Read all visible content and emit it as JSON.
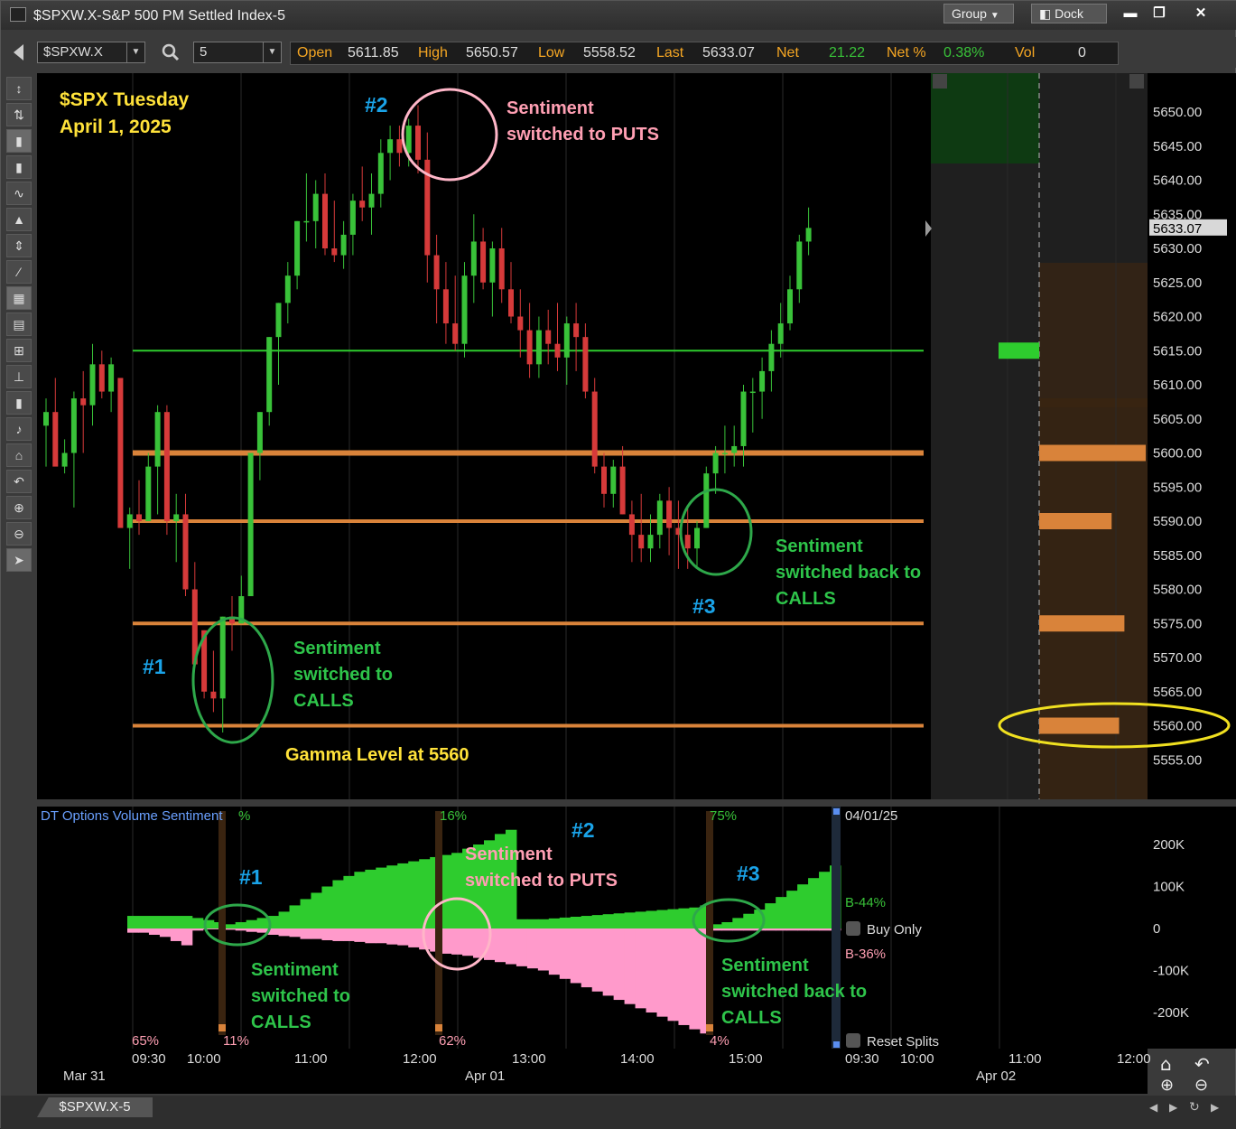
{
  "window": {
    "title": "$SPXW.X-S&P 500 PM Settled Index-5",
    "group_label": "Group",
    "dock_label": "Dock",
    "minimize_icon": "minimize-icon",
    "maximize_icon": "maximize-icon",
    "close_icon": "close-icon"
  },
  "toolbar": {
    "symbol": "$SPXW.X",
    "interval": "5",
    "quote": {
      "open_label": "Open",
      "open": "5611.85",
      "high_label": "High",
      "high": "5650.57",
      "low_label": "Low",
      "low": "5558.52",
      "last_label": "Last",
      "last": "5633.07",
      "net_label": "Net",
      "net": "21.22",
      "netpct_label": "Net %",
      "netpct": "0.38%",
      "vol_label": "Vol",
      "vol": "0"
    }
  },
  "left_tools": [
    "cursor-crosshair-icon",
    "pointer-icon",
    "candle-icon",
    "bar-icon",
    "line-icon",
    "area-icon",
    "fit-icon",
    "trendline-icon",
    "grid-icon",
    "table-icon",
    "level2-icon",
    "hline-icon",
    "flag-icon",
    "text-icon",
    "home-icon",
    "undo-icon",
    "zoom-in-icon",
    "zoom-out-icon",
    "select-icon"
  ],
  "colors": {
    "bg": "#000000",
    "up": "#39c239",
    "down": "#d63a3a",
    "orange": "#d9833a",
    "green_line": "#2ecc2e",
    "annot_green": "#2ec44a",
    "annot_pink": "#ff9fb3",
    "annot_blue": "#1aa3e8",
    "annot_yellow": "#ffe23a",
    "pos_fill": "#2ecc2e",
    "neg_fill": "#ff9acb"
  },
  "price_chart": {
    "title_line1": "$SPX Tuesday",
    "title_line2": "April 1, 2025",
    "y_ticks": [
      "5650.00",
      "5645.00",
      "5640.00",
      "5635.00",
      "5630.00",
      "5625.00",
      "5620.00",
      "5615.00",
      "5610.00",
      "5605.00",
      "5600.00",
      "5595.00",
      "5590.00",
      "5585.00",
      "5580.00",
      "5575.00",
      "5570.00",
      "5565.00",
      "5560.00",
      "5555.00"
    ],
    "last_price_tag": "5633.07",
    "annotations": {
      "n1": "#1",
      "n2": "#2",
      "n3": "#3",
      "a1": [
        "Sentiment",
        "switched to",
        "CALLS"
      ],
      "a2": [
        "Sentiment",
        "switched to PUTS"
      ],
      "a3": [
        "Sentiment",
        "switched back to",
        "CALLS"
      ],
      "gamma": "Gamma Level at 5560"
    }
  },
  "sentiment_panel": {
    "title": "DT Options Volume Sentiment",
    "pct_symbol": "%",
    "pct_top": [
      "16%",
      "75%"
    ],
    "pct_bottom": [
      "65%",
      "11%",
      "62%",
      "4%"
    ],
    "date_label": "04/01/25",
    "buy_label": "B-44%",
    "sell_label": "B-36%",
    "buy_only": "Buy Only",
    "reset_splits": "Reset Splits",
    "y_ticks": [
      "200K",
      "100K",
      "0",
      "-100K",
      "-200K"
    ],
    "annotations": {
      "n1": "#1",
      "n2": "#2",
      "n3": "#3",
      "a1": [
        "Sentiment",
        "switched to",
        "CALLS"
      ],
      "a2": [
        "Sentiment",
        "switched to PUTS"
      ],
      "a3": [
        "Sentiment",
        "switched back to",
        "CALLS"
      ]
    }
  },
  "x_axis": {
    "times": [
      "09:30",
      "10:00",
      "11:00",
      "12:00",
      "13:00",
      "14:00",
      "15:00",
      "09:30",
      "10:00",
      "11:00",
      "12:00"
    ],
    "dates": [
      "Mar 31",
      "Apr 01",
      "Apr 02"
    ]
  },
  "status": {
    "tab_label": "$SPXW.X-5"
  },
  "chart_data": {
    "type": "candlestick",
    "interval_minutes": 5,
    "date": "Apr 01",
    "ylim": [
      5550,
      5655
    ],
    "ohlc": [
      [
        5604,
        5608,
        5598,
        5606
      ],
      [
        5606,
        5611,
        5599,
        5598
      ],
      [
        5598,
        5602,
        5597,
        5600
      ],
      [
        5600,
        5609,
        5592,
        5608
      ],
      [
        5608,
        5612,
        5600,
        5607
      ],
      [
        5607,
        5616,
        5604,
        5613
      ],
      [
        5613,
        5615,
        5608,
        5609
      ],
      [
        5609,
        5614,
        5606,
        5613
      ],
      [
        5611,
        5611,
        5589,
        5589
      ],
      [
        5589,
        5592,
        5583,
        5591
      ],
      [
        5591,
        5596,
        5588,
        5590
      ],
      [
        5590,
        5600,
        5590,
        5598
      ],
      [
        5598,
        5607,
        5591,
        5606
      ],
      [
        5606,
        5607,
        5588,
        5590
      ],
      [
        5590,
        5594,
        5584,
        5591
      ],
      [
        5591,
        5594,
        5579,
        5580
      ],
      [
        5580,
        5584,
        5573,
        5569
      ],
      [
        5574,
        5574,
        5564,
        5565
      ],
      [
        5565,
        5571,
        5562,
        5564
      ],
      [
        5564,
        5576,
        5559,
        5576
      ],
      [
        5576,
        5579,
        5571,
        5575
      ],
      [
        5575,
        5582,
        5575,
        5579
      ],
      [
        5579,
        5600,
        5579,
        5600
      ],
      [
        5600,
        5606,
        5596,
        5606
      ],
      [
        5606,
        5617,
        5604,
        5617
      ],
      [
        5617,
        5622,
        5610,
        5622
      ],
      [
        5622,
        5628,
        5619,
        5626
      ],
      [
        5626,
        5634,
        5624,
        5634
      ],
      [
        5634,
        5641,
        5631,
        5634
      ],
      [
        5634,
        5640,
        5630,
        5638
      ],
      [
        5638,
        5641,
        5629,
        5630
      ],
      [
        5630,
        5637,
        5628,
        5629
      ],
      [
        5629,
        5634,
        5627,
        5632
      ],
      [
        5632,
        5638,
        5629,
        5637
      ],
      [
        5637,
        5642,
        5634,
        5636
      ],
      [
        5636,
        5641,
        5632,
        5638
      ],
      [
        5638,
        5646,
        5636,
        5644
      ],
      [
        5644,
        5648,
        5640,
        5646
      ],
      [
        5646,
        5648,
        5642,
        5644
      ],
      [
        5644,
        5649,
        5642,
        5648
      ],
      [
        5648,
        5651,
        5641,
        5643
      ],
      [
        5643,
        5647,
        5625,
        5629
      ],
      [
        5629,
        5632,
        5619,
        5624
      ],
      [
        5624,
        5628,
        5616,
        5619
      ],
      [
        5619,
        5626,
        5615,
        5616
      ],
      [
        5616,
        5628,
        5614,
        5626
      ],
      [
        5626,
        5635,
        5622,
        5631
      ],
      [
        5631,
        5633,
        5624,
        5625
      ],
      [
        5625,
        5631,
        5620,
        5630
      ],
      [
        5630,
        5633,
        5622,
        5624
      ],
      [
        5624,
        5628,
        5619,
        5620
      ],
      [
        5620,
        5624,
        5614,
        5618
      ],
      [
        5618,
        5622,
        5611,
        5613
      ],
      [
        5613,
        5620,
        5611,
        5618
      ],
      [
        5618,
        5621,
        5613,
        5616
      ],
      [
        5616,
        5622,
        5612,
        5614
      ],
      [
        5614,
        5620,
        5610,
        5619
      ],
      [
        5619,
        5622,
        5612,
        5617
      ],
      [
        5617,
        5619,
        5608,
        5609
      ],
      [
        5609,
        5611,
        5597,
        5598
      ],
      [
        5598,
        5600,
        5592,
        5594
      ],
      [
        5594,
        5599,
        5592,
        5598
      ],
      [
        5598,
        5601,
        5591,
        5591
      ],
      [
        5591,
        5593,
        5584,
        5588
      ],
      [
        5588,
        5594,
        5584,
        5586
      ],
      [
        5586,
        5591,
        5584,
        5588
      ],
      [
        5588,
        5594,
        5586,
        5593
      ],
      [
        5593,
        5595,
        5585,
        5589
      ],
      [
        5589,
        5593,
        5583,
        5588
      ],
      [
        5588,
        5592,
        5583,
        5586
      ],
      [
        5586,
        5590,
        5583,
        5589
      ],
      [
        5589,
        5598,
        5589,
        5597
      ],
      [
        5597,
        5601,
        5594,
        5600
      ],
      [
        5600,
        5604,
        5597,
        5600
      ],
      [
        5600,
        5604,
        5598,
        5601
      ],
      [
        5601,
        5610,
        5598,
        5609
      ],
      [
        5609,
        5611,
        5603,
        5609
      ],
      [
        5609,
        5614,
        5605,
        5612
      ],
      [
        5612,
        5618,
        5609,
        5616
      ],
      [
        5616,
        5622,
        5614,
        5619
      ],
      [
        5619,
        5626,
        5618,
        5624
      ],
      [
        5624,
        5632,
        5622,
        5631
      ],
      [
        5631,
        5636,
        5629,
        5633
      ]
    ],
    "levels": [
      {
        "price": 5615,
        "kind": "green"
      },
      {
        "price": 5600,
        "kind": "gamma"
      },
      {
        "price": 5590,
        "kind": "gamma"
      },
      {
        "price": 5575,
        "kind": "gamma"
      },
      {
        "price": 5560,
        "kind": "gamma"
      }
    ],
    "gamma_bars": [
      {
        "price": 5600,
        "strength": 1.0
      },
      {
        "price": 5590,
        "strength": 0.68
      },
      {
        "price": 5575,
        "strength": 0.8
      },
      {
        "price": 5560,
        "strength": 0.75
      }
    ],
    "sentiment": {
      "ylim": [
        -250000,
        250000
      ],
      "buy": [
        30000,
        30000,
        30000,
        30000,
        30000,
        30000,
        25000,
        20000,
        15000,
        10000,
        15000,
        20000,
        25000,
        30000,
        40000,
        55000,
        70000,
        85000,
        100000,
        115000,
        125000,
        135000,
        140000,
        145000,
        150000,
        155000,
        160000,
        165000,
        170000,
        175000,
        180000,
        190000,
        200000,
        210000,
        225000,
        235000,
        22000,
        22000,
        22000,
        24000,
        26000,
        28000,
        30000,
        32000,
        34000,
        36000,
        38000,
        40000,
        42000,
        44000,
        46000,
        48000,
        50000,
        55000,
        10000,
        15000,
        25000,
        35000,
        45000,
        60000,
        75000,
        90000,
        105000,
        120000,
        135000,
        150000
      ],
      "sell": [
        -10000,
        -10000,
        -15000,
        -20000,
        -30000,
        -40000,
        -5000,
        -2000,
        -2000,
        -3000,
        -5000,
        -8000,
        -10000,
        -15000,
        -18000,
        -20000,
        -25000,
        -25000,
        -28000,
        -30000,
        -30000,
        -32000,
        -35000,
        -35000,
        -38000,
        -40000,
        -45000,
        -50000,
        -55000,
        -60000,
        -62000,
        -65000,
        -70000,
        -75000,
        -80000,
        -85000,
        -90000,
        -95000,
        -100000,
        -110000,
        -120000,
        -130000,
        -140000,
        -150000,
        -160000,
        -170000,
        -180000,
        -190000,
        -200000,
        -210000,
        -220000,
        -230000,
        -240000,
        -250000,
        -5000,
        -5000,
        -5000,
        -5000,
        -5000,
        -5000,
        -5000,
        -5000,
        -5000,
        -5000,
        -5000,
        -5000
      ]
    }
  }
}
